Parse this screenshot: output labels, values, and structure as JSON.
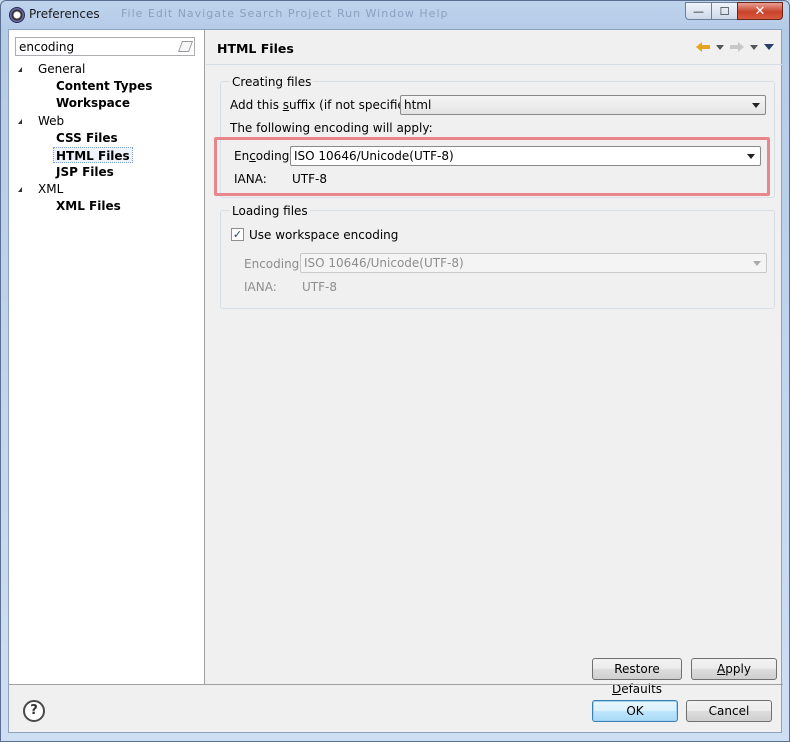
{
  "window": {
    "title": "Preferences",
    "ghost_menu": "File Edit Navigate Search Project Run Window Help",
    "min_glyph": "—",
    "max_glyph": "☐",
    "close_glyph": "✕"
  },
  "filter": {
    "value": "encoding"
  },
  "tree": [
    {
      "label": "General",
      "level": 0,
      "expanded": true
    },
    {
      "label": "Content Types",
      "level": 1
    },
    {
      "label": "Workspace",
      "level": 1
    },
    {
      "label": "Web",
      "level": 0,
      "expanded": true
    },
    {
      "label": "CSS Files",
      "level": 1
    },
    {
      "label": "HTML Files",
      "level": 1,
      "selected": true
    },
    {
      "label": "JSP Files",
      "level": 1
    },
    {
      "label": "XML",
      "level": 0,
      "expanded": true
    },
    {
      "label": "XML Files",
      "level": 1
    }
  ],
  "page": {
    "title": "HTML Files",
    "creating": {
      "group_label": "Creating files",
      "suffix_label_pre": "Add this ",
      "suffix_label_u": "s",
      "suffix_label_post": "uffix (if not specified):",
      "suffix_value": "html",
      "apply_text": "The following encoding will apply:",
      "encoding_label_pre": "En",
      "encoding_label_u": "c",
      "encoding_label_post": "oding:",
      "encoding_value": "ISO 10646/Unicode(UTF-8)",
      "iana_label": "IANA:",
      "iana_value": "UTF-8"
    },
    "loading": {
      "group_label": "Loading files",
      "use_workspace_label": "Use workspace encoding",
      "use_workspace_checked": true,
      "encoding_label": "Encoding:",
      "encoding_value": "ISO 10646/Unicode(UTF-8)",
      "iana_label": "IANA:",
      "iana_value": "UTF-8"
    },
    "restore_pre": "Restore ",
    "restore_u": "D",
    "restore_post": "efaults",
    "apply_pre": "",
    "apply_u": "A",
    "apply_post": "pply"
  },
  "footer": {
    "help": "?",
    "ok": "OK",
    "cancel": "Cancel"
  },
  "colors": {
    "highlight": "#e9858c",
    "back_arrow": "#e6a421"
  },
  "icons": [
    "app-icon",
    "eraser-icon",
    "back-arrow-icon",
    "forward-arrow-icon",
    "menu-icon",
    "help-icon"
  ]
}
